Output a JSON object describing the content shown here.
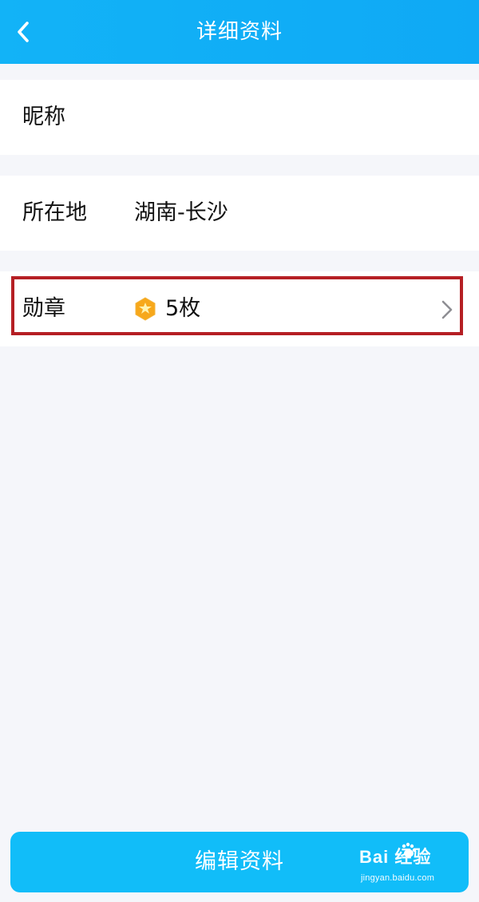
{
  "header": {
    "title": "详细资料"
  },
  "profile": {
    "nickname_label": "昵称",
    "location_label": "所在地",
    "location_value": "湖南-长沙",
    "badge_label": "勋章",
    "badge_count": "5枚"
  },
  "footer": {
    "edit_button_label": "编辑资料"
  },
  "watermark": {
    "brand": "Bai 经验",
    "url": "jingyan.baidu.com"
  },
  "colors": {
    "header_blue": "#12b3f7",
    "button_blue": "#11bdf9",
    "highlight_red": "#b51f24"
  }
}
